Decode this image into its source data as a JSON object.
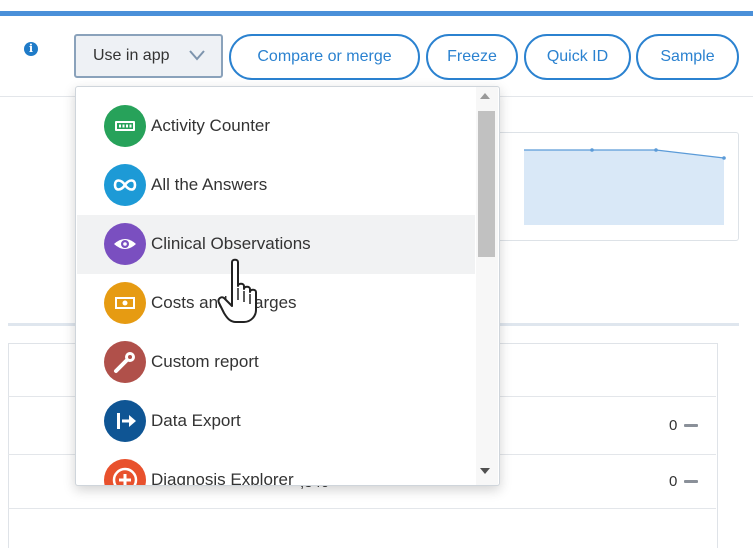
{
  "toolbar": {
    "info_icon": "info-icon",
    "use_in_app_label": "Use in app",
    "compare_label": "Compare or merge",
    "freeze_label": "Freeze",
    "quick_id_label": "Quick ID",
    "sample_label": "Sample",
    "accent_color": "#2b82d0"
  },
  "dropdown": {
    "items": [
      {
        "label": "Activity Counter",
        "icon": "counter-icon",
        "color": "#27a25a"
      },
      {
        "label": "All the Answers",
        "icon": "infinity-icon",
        "color": "#1d9ad6"
      },
      {
        "label": "Clinical Observations",
        "icon": "eye-icon",
        "color": "#7a4fc0"
      },
      {
        "label": "Costs and Charges",
        "icon": "money-icon",
        "color": "#e69b12"
      },
      {
        "label": "Custom report",
        "icon": "custom-report-icon",
        "color": "#b0504a"
      },
      {
        "label": "Data Export",
        "icon": "export-icon",
        "color": "#0f5594"
      },
      {
        "label": "Diagnosis Explorer",
        "icon": "plus-icon",
        "color": "#e8512d"
      }
    ]
  },
  "table": {
    "row1_value": "0",
    "row2_value": "0",
    "partial_text": ",340"
  }
}
